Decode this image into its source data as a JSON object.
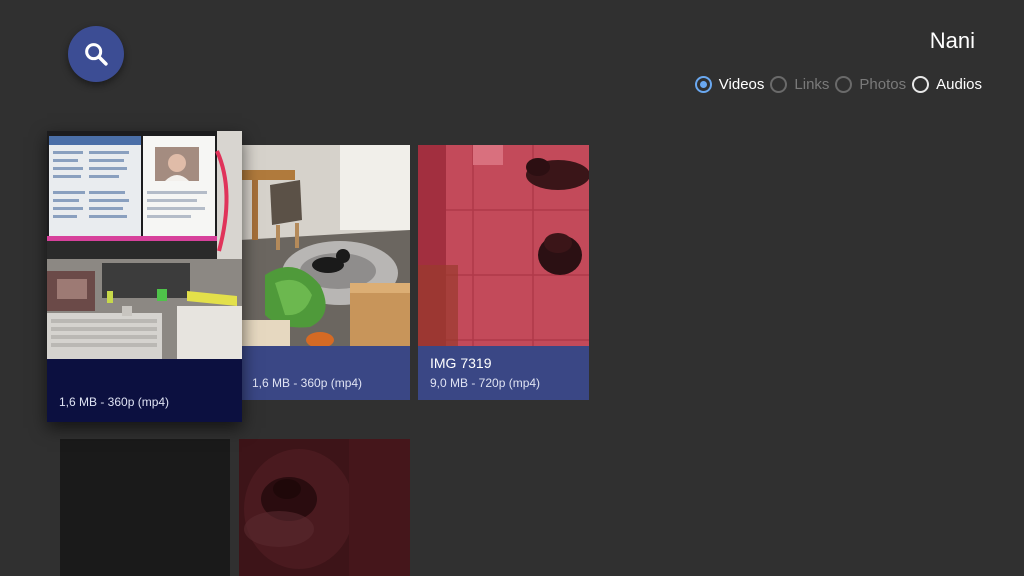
{
  "header": {
    "profile_name": "Nani",
    "search_icon": "search-icon"
  },
  "filters": [
    {
      "label": "Videos",
      "checked": true,
      "enabled": true
    },
    {
      "label": "Links",
      "checked": false,
      "enabled": false
    },
    {
      "label": "Photos",
      "checked": false,
      "enabled": false
    },
    {
      "label": "Audios",
      "checked": false,
      "enabled": true
    }
  ],
  "videos": [
    {
      "title": "",
      "meta": "1,6 MB - 360p (mp4)",
      "focused": true
    },
    {
      "title": "",
      "meta": "1,6 MB - 360p (mp4)",
      "focused": false
    },
    {
      "title": "IMG 7319",
      "meta": "9,0 MB - 720p (mp4)",
      "focused": false
    },
    {
      "title": "",
      "meta": "",
      "focused": false
    },
    {
      "title": "",
      "meta": "",
      "focused": false
    }
  ],
  "colors": {
    "background": "#303030",
    "accent": "#3c4d94",
    "card_info": "#3a4785",
    "card_info_focused": "#0c1040",
    "radio_selected": "#6aa8f0"
  }
}
